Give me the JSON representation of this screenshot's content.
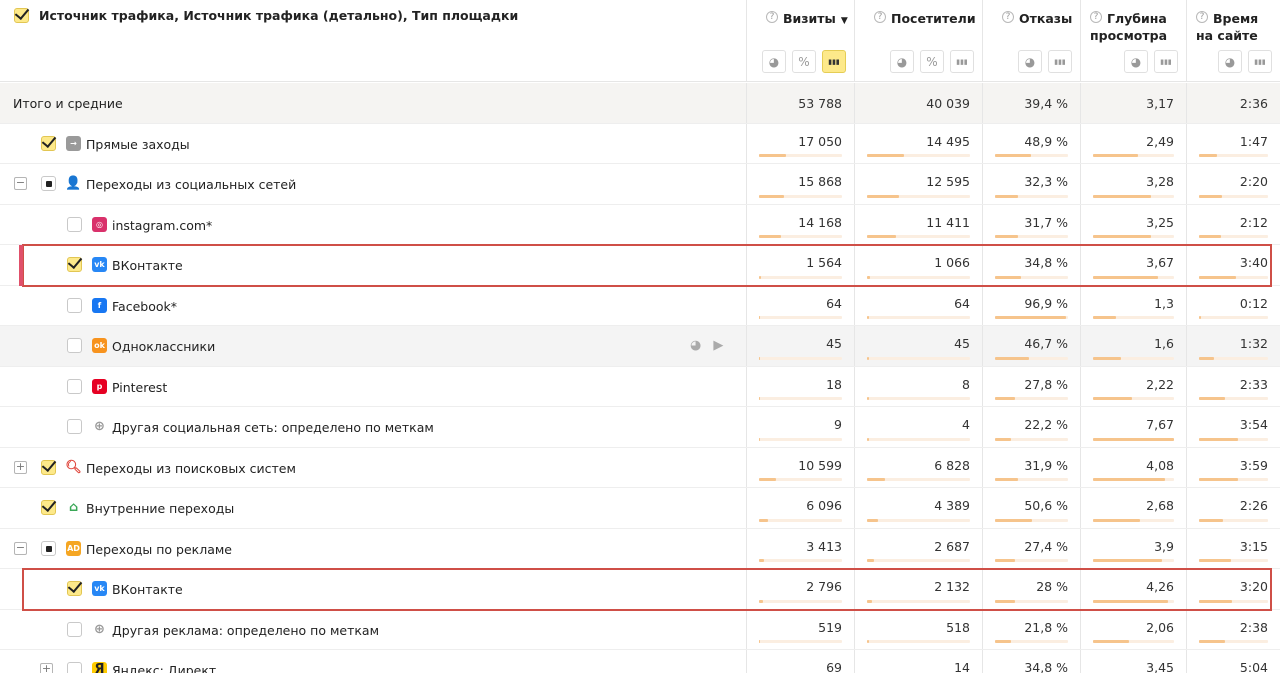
{
  "colors": {
    "accent": "#fde98a",
    "highlight": "#cf4f47",
    "bar": "#f6c48c",
    "selection_marker": "#e0506a"
  },
  "header": {
    "dimension_title": "Источник трафика, Источник трафика (детально), Тип площадки",
    "metrics": [
      {
        "title_line1": "Визиты",
        "title_line2": "",
        "sorted": true,
        "sort_arrow": "▼",
        "buttons": [
          "pie-icon",
          "percent-icon",
          "bars-icon"
        ],
        "active_button": "bars-icon"
      },
      {
        "title_line1": "Посетители",
        "title_line2": "",
        "sorted": false,
        "buttons": [
          "pie-icon",
          "percent-icon",
          "bars-icon"
        ],
        "active_button": ""
      },
      {
        "title_line1": "Отказы",
        "title_line2": "",
        "sorted": false,
        "buttons": [
          "pie-icon",
          "bars-icon"
        ],
        "active_button": ""
      },
      {
        "title_line1": "Глубина",
        "title_line2": "просмотра",
        "sorted": false,
        "buttons": [
          "pie-icon",
          "bars-icon"
        ],
        "active_button": ""
      },
      {
        "title_line1": "Время",
        "title_line2": "на сайте",
        "sorted": false,
        "buttons": [
          "pie-icon",
          "bars-icon"
        ],
        "active_button": ""
      }
    ],
    "button_glyphs": {
      "pie-icon": "◕",
      "percent-icon": "%",
      "bars-icon": "▮▮▮"
    }
  },
  "rows": [
    {
      "label": "Итого и средние",
      "type": "total",
      "level": 0,
      "values": [
        "53 788",
        "40 039",
        "39,4 %",
        "3,17",
        "2:36"
      ],
      "bars": [
        0,
        0,
        0,
        0,
        0
      ]
    },
    {
      "label": "Прямые заходы",
      "level": 1,
      "checkbox": "checked",
      "expander": "",
      "icon": "direct",
      "values": [
        "17 050",
        "14 495",
        "48,9 %",
        "2,49",
        "1:47"
      ],
      "bars": [
        0.32,
        0.36,
        0.49,
        0.55,
        0.26
      ]
    },
    {
      "label": "Переходы из социальных сетей",
      "level": 1,
      "checkbox": "partial",
      "expander": "−",
      "icon": "social",
      "values": [
        "15 868",
        "12 595",
        "32,3 %",
        "3,28",
        "2:20"
      ],
      "bars": [
        0.3,
        0.31,
        0.32,
        0.72,
        0.34
      ]
    },
    {
      "label": "instagram.com*",
      "level": 2,
      "checkbox": "unchecked",
      "expander": "",
      "icon": "instagram",
      "values": [
        "14 168",
        "11 411",
        "31,7 %",
        "3,25",
        "2:12"
      ],
      "bars": [
        0.26,
        0.28,
        0.32,
        0.71,
        0.32
      ]
    },
    {
      "label": "ВКонтакте",
      "level": 2,
      "checkbox": "checked",
      "expander": "",
      "icon": "vk",
      "highlighted": true,
      "values": [
        "1 564",
        "1 066",
        "34,8 %",
        "3,67",
        "3:40"
      ],
      "bars": [
        0.03,
        0.03,
        0.35,
        0.8,
        0.53
      ]
    },
    {
      "label": "Facebook*",
      "level": 2,
      "checkbox": "unchecked",
      "expander": "",
      "icon": "facebook",
      "values": [
        "64",
        "64",
        "96,9 %",
        "1,3",
        "0:12"
      ],
      "bars": [
        0.005,
        0.005,
        0.97,
        0.28,
        0.03
      ]
    },
    {
      "label": "Одноклассники",
      "level": 2,
      "checkbox": "unchecked",
      "expander": "",
      "icon": "ok",
      "hover": true,
      "values": [
        "45",
        "45",
        "46,7 %",
        "1,6",
        "1:32"
      ],
      "bars": [
        0.004,
        0.004,
        0.47,
        0.35,
        0.22
      ]
    },
    {
      "label": "Pinterest",
      "level": 2,
      "checkbox": "unchecked",
      "expander": "",
      "icon": "pinterest",
      "values": [
        "18",
        "8",
        "27,8 %",
        "2,22",
        "2:33"
      ],
      "bars": [
        0.002,
        0.001,
        0.28,
        0.48,
        0.37
      ]
    },
    {
      "label": "Другая социальная сеть: определено по меткам",
      "level": 2,
      "checkbox": "unchecked",
      "expander": "",
      "icon": "globe",
      "values": [
        "9",
        "4",
        "22,2 %",
        "7,67",
        "3:54"
      ],
      "bars": [
        0.001,
        0.001,
        0.22,
        1.0,
        0.56
      ]
    },
    {
      "label": "Переходы из поисковых систем",
      "level": 1,
      "checkbox": "checked",
      "expander": "+",
      "icon": "search",
      "values": [
        "10 599",
        "6 828",
        "31,9 %",
        "4,08",
        "3:59"
      ],
      "bars": [
        0.2,
        0.17,
        0.32,
        0.89,
        0.57
      ]
    },
    {
      "label": "Внутренние переходы",
      "level": 1,
      "checkbox": "checked",
      "expander": "",
      "icon": "home",
      "values": [
        "6 096",
        "4 389",
        "50,6 %",
        "2,68",
        "2:26"
      ],
      "bars": [
        0.11,
        0.11,
        0.51,
        0.58,
        0.35
      ]
    },
    {
      "label": "Переходы по рекламе",
      "level": 1,
      "checkbox": "partial",
      "expander": "−",
      "icon": "ad",
      "values": [
        "3 413",
        "2 687",
        "27,4 %",
        "3,9",
        "3:15"
      ],
      "bars": [
        0.06,
        0.07,
        0.27,
        0.85,
        0.47
      ]
    },
    {
      "label": "ВКонтакте",
      "level": 2,
      "checkbox": "checked",
      "expander": "",
      "icon": "vk",
      "highlighted": true,
      "values": [
        "2 796",
        "2 132",
        "28 %",
        "4,26",
        "3:20"
      ],
      "bars": [
        0.05,
        0.05,
        0.28,
        0.93,
        0.48
      ]
    },
    {
      "label": "Другая реклама: определено по меткам",
      "level": 2,
      "checkbox": "unchecked",
      "expander": "",
      "icon": "globe",
      "values": [
        "519",
        "518",
        "21,8 %",
        "2,06",
        "2:38"
      ],
      "bars": [
        0.01,
        0.013,
        0.22,
        0.45,
        0.38
      ]
    },
    {
      "label": "Яндекс: Директ",
      "level": 2,
      "checkbox": "unchecked",
      "expander": "+",
      "icon": "yandex-direct",
      "values": [
        "69",
        "14",
        "34,8 %",
        "3,45",
        "5:04"
      ],
      "bars": [
        0.001,
        0.0005,
        0.35,
        0.75,
        0.73
      ]
    }
  ]
}
